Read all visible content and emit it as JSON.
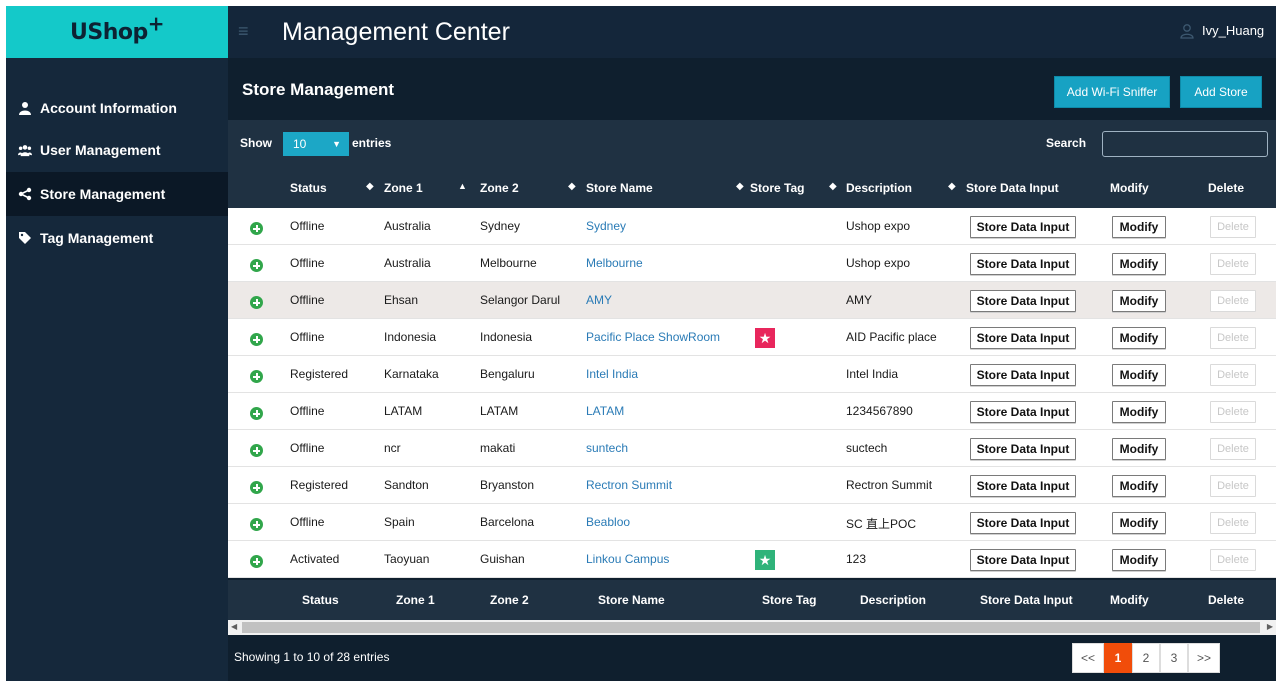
{
  "app": {
    "logo_text": "UShop",
    "logo_plus": "+",
    "title": "Management Center",
    "user_name": "Ivy_Huang"
  },
  "sidebar": {
    "items": [
      {
        "label": "Account Information",
        "icon": "user-icon",
        "active": false
      },
      {
        "label": "User Management",
        "icon": "users-icon",
        "active": false
      },
      {
        "label": "Store Management",
        "icon": "share-icon",
        "active": true
      },
      {
        "label": "Tag Management",
        "icon": "tag-icon",
        "active": false
      }
    ]
  },
  "page": {
    "title": "Store Management",
    "add_sniffer_label": "Add Wi-Fi Sniffer",
    "add_store_label": "Add Store"
  },
  "controls": {
    "show_label": "Show",
    "page_size": "10",
    "entries_label": "entries",
    "search_label": "Search",
    "search_value": ""
  },
  "table": {
    "headers": [
      "Status",
      "Zone 1",
      "Zone 2",
      "Store Name",
      "Store Tag",
      "Description",
      "Store Data Input",
      "Modify",
      "Delete"
    ],
    "footer_headers": [
      "Status",
      "Zone 1",
      "Zone 2",
      "Store Name",
      "Store Tag",
      "Description",
      "Store Data Input",
      "Modify",
      "Delete"
    ],
    "sort_asc_column": "Zone 1",
    "button_labels": {
      "data_input": "Store Data Input",
      "modify": "Modify",
      "delete": "Delete"
    },
    "rows": [
      {
        "status": "Offline",
        "zone1": "Australia",
        "zone2": "Sydney",
        "store": "Sydney",
        "tag": "",
        "description": "Ushop expo",
        "highlight": false
      },
      {
        "status": "Offline",
        "zone1": "Australia",
        "zone2": "Melbourne",
        "store": "Melbourne",
        "tag": "",
        "description": "Ushop expo",
        "highlight": false
      },
      {
        "status": "Offline",
        "zone1": "Ehsan",
        "zone2": "Selangor Darul",
        "store": "AMY",
        "tag": "",
        "description": "AMY",
        "highlight": true
      },
      {
        "status": "Offline",
        "zone1": "Indonesia",
        "zone2": "Indonesia",
        "store": "Pacific Place ShowRoom",
        "tag": "pink-star",
        "description": "AID Pacific place",
        "highlight": false
      },
      {
        "status": "Registered",
        "zone1": "Karnataka",
        "zone2": "Bengaluru",
        "store": "Intel India",
        "tag": "",
        "description": "Intel India",
        "highlight": false
      },
      {
        "status": "Offline",
        "zone1": "LATAM",
        "zone2": "LATAM",
        "store": "LATAM",
        "tag": "",
        "description": "1234567890",
        "highlight": false
      },
      {
        "status": "Offline",
        "zone1": "ncr",
        "zone2": "makati",
        "store": "suntech",
        "tag": "",
        "description": "suctech",
        "highlight": false
      },
      {
        "status": "Registered",
        "zone1": "Sandton",
        "zone2": "Bryanston",
        "store": "Rectron Summit",
        "tag": "",
        "description": "Rectron Summit",
        "highlight": false
      },
      {
        "status": "Offline",
        "zone1": "Spain",
        "zone2": "Barcelona",
        "store": "Beabloo",
        "tag": "",
        "description": "SC 直上POC",
        "highlight": false
      },
      {
        "status": "Activated",
        "zone1": "Taoyuan",
        "zone2": "Guishan",
        "store": "Linkou Campus",
        "tag": "green-star",
        "description": "123",
        "highlight": false
      }
    ]
  },
  "footer": {
    "info": "Showing 1 to 10 of 28 entries",
    "pages": [
      "<<",
      "1",
      "2",
      "3",
      ">>"
    ],
    "current_page": "1"
  },
  "colors": {
    "accent": "#14c9c9",
    "button": "#17a2c3",
    "link": "#2a7bb6",
    "pager_active": "#f14d0a",
    "pink_tag": "#e8265c",
    "green_tag": "#2fb37a",
    "expand": "#31a64b"
  }
}
